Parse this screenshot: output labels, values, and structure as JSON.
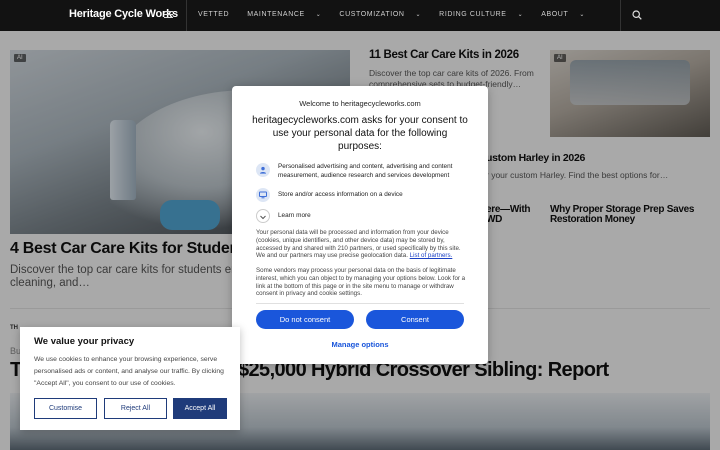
{
  "header": {
    "brand": "Heritage Cycle Works",
    "nav": [
      "VETTED",
      "MAINTENANCE",
      "CUSTOMIZATION",
      "RIDING CULTURE",
      "ABOUT"
    ],
    "nav_has_chevron": [
      false,
      true,
      true,
      true,
      true
    ]
  },
  "content": {
    "ai_tag": "AI",
    "left_title": "4 Best Car Care Kits for Students in",
    "left_desc": "Discover the top car care kits for students emergency, cleaning, and…",
    "right1_title": "11 Best Car Care Kits in 2026",
    "right1_desc": "Discover the top car care kits of 2026. From comprehensive sets to budget-friendly…",
    "right2_title": "ustom Harley in 2026",
    "right2_desc": "r your custom Harley. Find the best options for…",
    "right3_title": "ere—With\nWD",
    "right4_title": "Why Proper Storage Prep Saves Restoration Money",
    "section_label": "TH",
    "kicker": "Bu",
    "main_title_left": "T",
    "main_title_right": "$25,000 Hybrid Crossover Sibling: Report"
  },
  "consent": {
    "site": "Welcome to heritagecycleworks.com",
    "title": "heritagecycleworks.com asks for your consent to use your personal data for the following purposes:",
    "purpose1": "Personalised advertising and content, advertising and content measurement, audience research and services development",
    "purpose2": "Store and/or access information on a device",
    "learn_more": "Learn more",
    "body1": "Your personal data will be processed and information from your device (cookies, unique identifiers, and other device data) may be stored by, accessed by and shared with 210 partners, or used specifically by this site. We and our partners may use precise geolocation data.",
    "body1_link": "List of partners.",
    "body2": "Some vendors may process your personal data on the basis of legitimate interest, which you can object to by managing your options below. Look for a link at the bottom of this page or in the site menu to manage or withdraw consent in privacy and cookie settings.",
    "do_not_consent": "Do not consent",
    "consent": "Consent",
    "manage_options": "Manage options",
    "accent_color": "#1a56db"
  },
  "privacy": {
    "title": "We value your privacy",
    "text": "We use cookies to enhance your browsing experience, serve personalised ads or content, and analyse our traffic. By clicking \"Accept All\", you consent to our use of cookies.",
    "customise": "Customise",
    "reject_all": "Reject All",
    "accept_all": "Accept All",
    "accent_color": "#1f3b7a"
  }
}
